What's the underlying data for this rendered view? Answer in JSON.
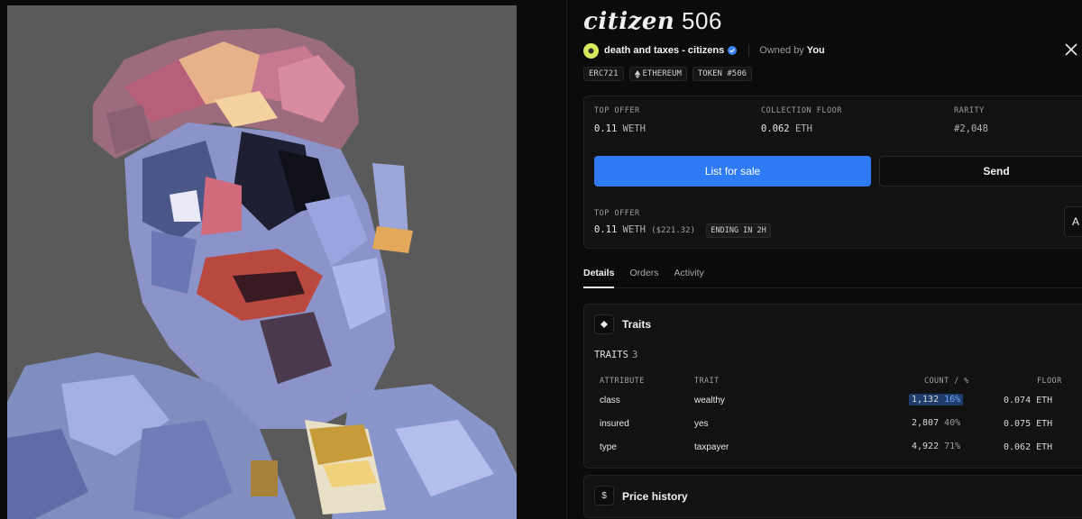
{
  "nft": {
    "title_script": "citizen",
    "title_number": "506",
    "collection_name": "death and taxes - citizens",
    "owned_by_label": "Owned by",
    "owner": "You"
  },
  "chips": [
    {
      "label": "ERC721"
    },
    {
      "label": "ETHEREUM",
      "icon": "ethereum-icon"
    },
    {
      "label": "TOKEN #506"
    }
  ],
  "stats": {
    "top_offer": {
      "label": "TOP OFFER",
      "value": "0.11",
      "unit": "WETH"
    },
    "collection_floor": {
      "label": "COLLECTION FLOOR",
      "value": "0.062",
      "unit": "ETH"
    },
    "rarity": {
      "label": "RARITY",
      "value": "#2,048"
    }
  },
  "actions": {
    "list_for_sale": "List for sale",
    "send": "Send",
    "extra_button_partial": "A"
  },
  "top_offer_detail": {
    "label": "TOP OFFER",
    "value": "0.11",
    "unit": "WETH",
    "usd": "($221.32)",
    "ending": "ENDING IN 2H"
  },
  "tabs": [
    {
      "label": "Details",
      "active": true
    },
    {
      "label": "Orders",
      "active": false
    },
    {
      "label": "Activity",
      "active": false
    }
  ],
  "traits": {
    "title": "Traits",
    "count_label": "TRAITS",
    "count": "3",
    "headers": {
      "attribute": "ATTRIBUTE",
      "trait": "TRAIT",
      "count": "COUNT / %",
      "floor": "FLOOR"
    },
    "rows": [
      {
        "attribute": "class",
        "trait": "wealthy",
        "count": "1,132",
        "pct": "16%",
        "floor": "0.074 ETH",
        "highlight": true
      },
      {
        "attribute": "insured",
        "trait": "yes",
        "count": "2,807",
        "pct": "40%",
        "floor": "0.075 ETH",
        "highlight": false
      },
      {
        "attribute": "type",
        "trait": "taxpayer",
        "count": "4,922",
        "pct": "71%",
        "floor": "0.062 ETH",
        "highlight": false
      }
    ]
  },
  "price_history": {
    "title": "Price history",
    "icon_glyph": "$"
  },
  "colors": {
    "accent": "#2f7bf5",
    "background": "#0b0b0b",
    "card": "#121212"
  }
}
